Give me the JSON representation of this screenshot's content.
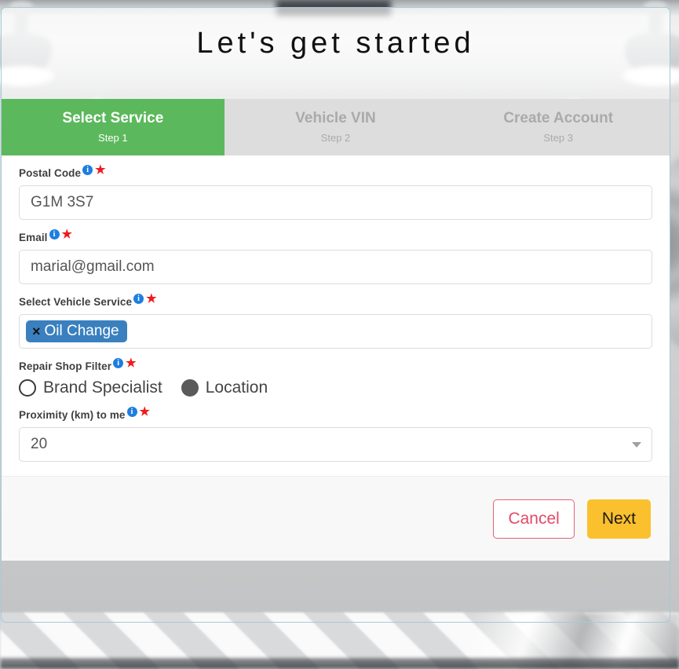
{
  "window": {
    "title": "Let's get started"
  },
  "steps": [
    {
      "title": "Select Service",
      "sub": "Step 1",
      "state": "active"
    },
    {
      "title": "Vehicle VIN",
      "sub": "Step 2",
      "state": "inactive"
    },
    {
      "title": "Create Account",
      "sub": "Step 3",
      "state": "inactive"
    }
  ],
  "form": {
    "postal_code": {
      "label": "Postal Code",
      "value": "G1M 3S7",
      "placeholder": "Postal Code",
      "info_icon": "info-circle-icon",
      "required_icon": "required-star-icon"
    },
    "email": {
      "label": "Email",
      "value": "marial@gmail.com",
      "placeholder": "Email",
      "info_icon": "info-circle-icon",
      "required_icon": "required-star-icon"
    },
    "vehicle_service": {
      "label": "Select Vehicle Service",
      "chips": [
        {
          "label": "Oil Change",
          "remove_icon": "×"
        }
      ],
      "placeholder": "Select Vehicle Service",
      "info_icon": "info-circle-icon",
      "required_icon": "required-star-icon"
    },
    "repair_shop_filter": {
      "label": "Repair Shop Filter",
      "info_icon": "info-circle-icon",
      "required_icon": "required-star-icon",
      "options": [
        {
          "label": "Brand Specialist",
          "selected": false
        },
        {
          "label": "Location",
          "selected": true
        }
      ]
    },
    "proximity": {
      "label": "Proximity (km) to me",
      "value": "20",
      "info_icon": "info-circle-icon",
      "required_icon": "required-star-icon",
      "caret_icon": "chevron-down-icon"
    }
  },
  "footer": {
    "cancel_label": "Cancel",
    "next_label": "Next"
  },
  "colors": {
    "step_active": "#5cb85c",
    "step_inactive": "#dddddd",
    "chip": "#3a80bf",
    "info": "#1d7ee0",
    "required": "#ef1b1b",
    "next_button": "#fbc02d",
    "cancel_border": "#e2607c",
    "cancel_text": "#e34a66"
  }
}
